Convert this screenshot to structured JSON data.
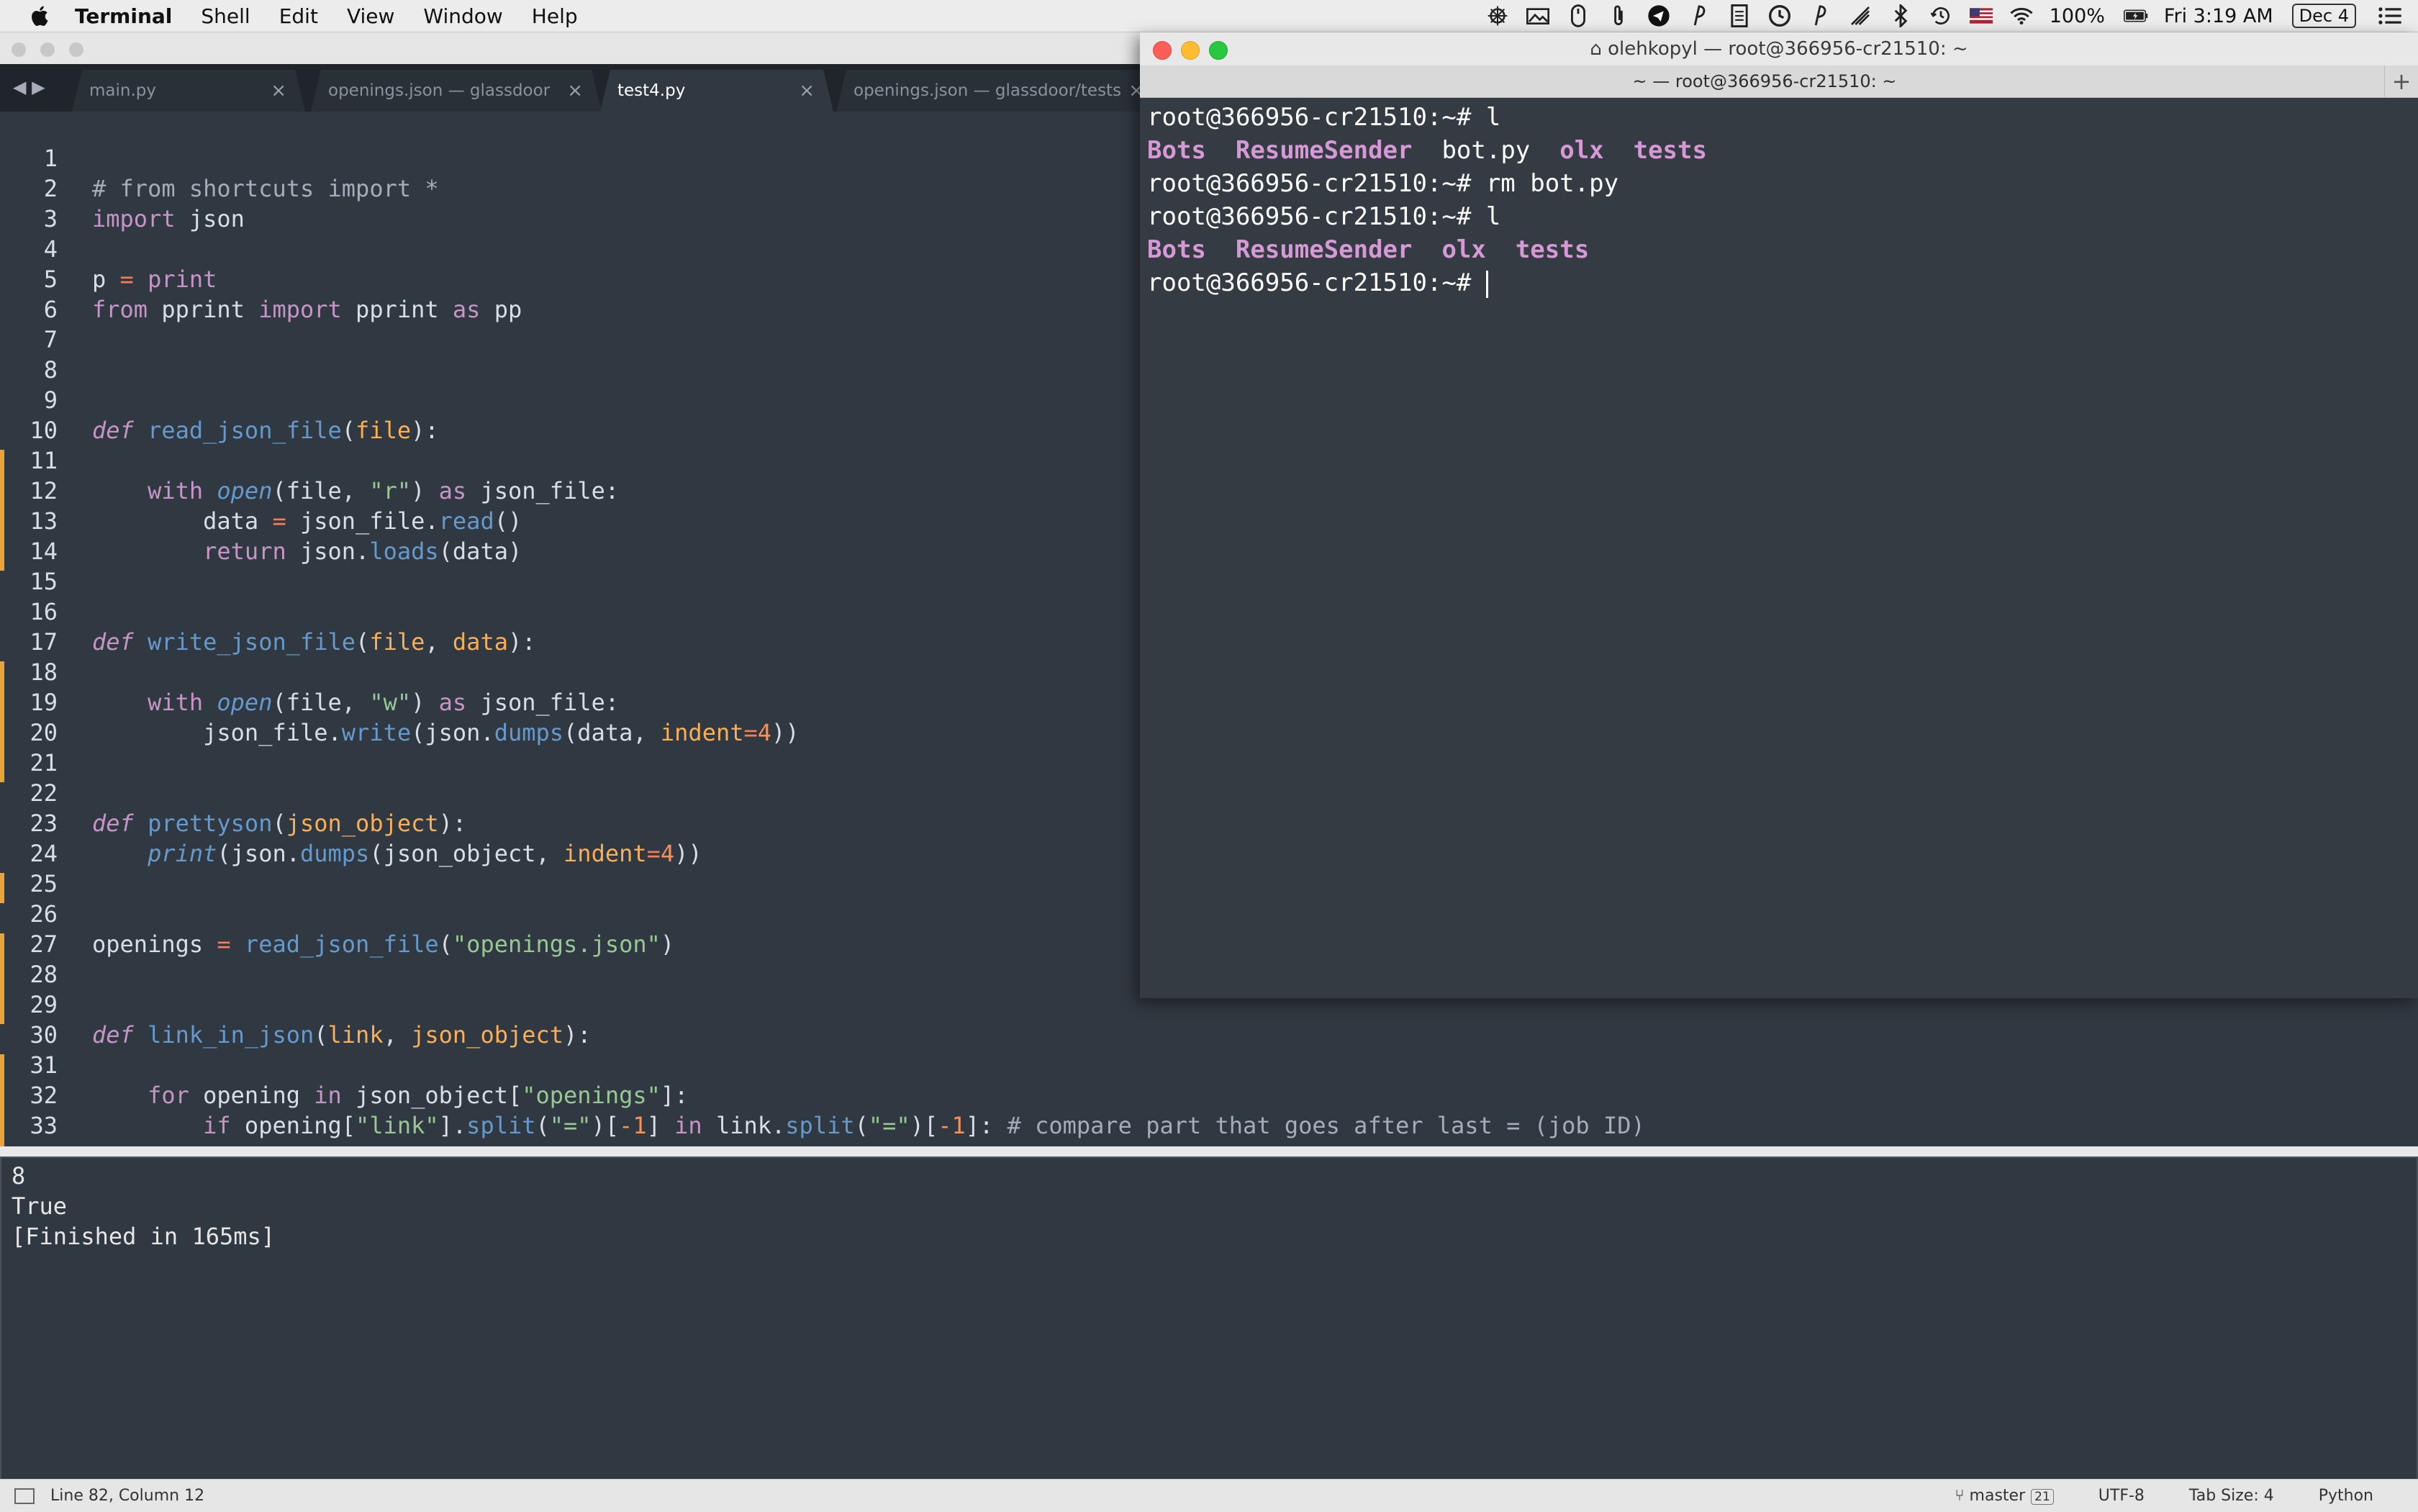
{
  "menubar": {
    "app_name": "Terminal",
    "items": [
      "Shell",
      "Edit",
      "View",
      "Window",
      "Help"
    ],
    "battery": "100%",
    "clock": "Fri 3:19 AM",
    "date_badge": "Dec 4"
  },
  "editor": {
    "tabs": [
      {
        "label": "main.py",
        "active": false
      },
      {
        "label": "openings.json — glassdoor",
        "active": false
      },
      {
        "label": "test4.py",
        "active": true
      },
      {
        "label": "openings.json — glassdoor/tests",
        "active": false
      }
    ],
    "line_numbers": [
      "1",
      "2",
      "3",
      "4",
      "5",
      "6",
      "7",
      "8",
      "9",
      "10",
      "11",
      "12",
      "13",
      "14",
      "15",
      "16",
      "17",
      "18",
      "19",
      "20",
      "21",
      "22",
      "23",
      "24",
      "25",
      "26",
      "27",
      "28",
      "29",
      "30",
      "31",
      "32",
      "33"
    ],
    "code": {
      "l2": "# from shortcuts import *",
      "l3_kw": "import",
      "l3_mod": " json",
      "l5_var": "p ",
      "l5_op": "=",
      "l5_fn": " print",
      "l6_from": "from",
      "l6_mod": " pprint ",
      "l6_import": "import",
      "l6_name": " pprint ",
      "l6_as": "as",
      "l6_alias": " pp",
      "def": "def",
      "l10_name": "read_json_file",
      "l10_param": "file",
      "l12_with": "with",
      "l12_open": "open",
      "l12_args": "(file, ",
      "l12_mode": "\"r\"",
      "l12_close": ") ",
      "l12_as": "as",
      "l12_var": " json_file:",
      "l13_a": "data ",
      "l13_op": "=",
      "l13_b": " json_file.",
      "l13_fn": "read",
      "l13_c": "()",
      "l14_ret": "return",
      "l14_a": " json.",
      "l14_fn": "loads",
      "l14_b": "(data)",
      "l17_name": "write_json_file",
      "l17_p1": "file",
      "l17_p2": "data",
      "l19_mode": "\"w\"",
      "l20_a": "json_file.",
      "l20_fn": "write",
      "l20_b": "(json.",
      "l20_fn2": "dumps",
      "l20_c": "(data, ",
      "l20_kw": "indent",
      "l20_op": "=",
      "l20_num": "4",
      "l20_d": "))",
      "l23_name": "prettyson",
      "l23_param": "json_object",
      "l24_print": "print",
      "l24_a": "(json.",
      "l24_fn": "dumps",
      "l24_b": "(json_object, ",
      "l24_kw": "indent",
      "l24_op": "=",
      "l24_num": "4",
      "l24_c": "))",
      "l27_var": "openings ",
      "l27_op": "=",
      "l27_fn": "read_json_file",
      "l27_str": "\"openings.json\"",
      "l30_name": "link_in_json",
      "l30_p1": "link",
      "l30_p2": "json_object",
      "l32_for": "for",
      "l32_a": " opening ",
      "l32_in": "in",
      "l32_b": " json_object[",
      "l32_str": "\"openings\"",
      "l32_c": "]:",
      "l33_if": "if",
      "l33_a": " opening[",
      "l33_s1": "\"link\"",
      "l33_b": "].",
      "l33_fn1": "split",
      "l33_c": "(",
      "l33_s2": "\"=\"",
      "l33_d": ")[",
      "l33_n1": "-1",
      "l33_e": "] ",
      "l33_in": "in",
      "l33_f": " link.",
      "l33_fn2": "split",
      "l33_g": "(",
      "l33_s3": "\"=\"",
      "l33_h": ")[",
      "l33_n2": "-1",
      "l33_i": "]: ",
      "l33_cm": "# compare part that goes after last = (job ID)"
    },
    "output": [
      "8",
      "True",
      "[Finished in 165ms]"
    ],
    "status": {
      "position": "Line 82, Column 12",
      "branch": "master",
      "branch_count": "21",
      "encoding": "UTF-8",
      "tab_size": "Tab Size: 4",
      "syntax": "Python"
    }
  },
  "terminal": {
    "title": "olehkopyl — root@366956-cr21510: ~",
    "tab_title": "~ — root@366956-cr21510: ~",
    "prompt": "root@366956-cr21510:~# ",
    "cmd1": "l",
    "ls1": {
      "d1": "Bots",
      "d2": "ResumeSender",
      "f1": "bot.py",
      "d3": "olx",
      "d4": "tests"
    },
    "cmd2": "rm bot.py",
    "cmd3": "l",
    "ls2": {
      "d1": "Bots",
      "d2": "ResumeSender",
      "d3": "olx",
      "d4": "tests"
    }
  },
  "colors": {
    "editor_bg": "#303841",
    "keyword": "#c695c6",
    "function": "#6699cc",
    "string": "#99c794",
    "number": "#f99157",
    "param": "#f9ae58",
    "directory": "#d699d6"
  }
}
